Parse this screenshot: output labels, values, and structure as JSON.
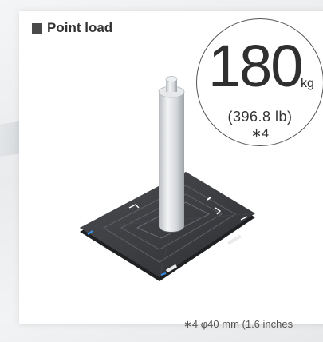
{
  "section": {
    "title": "Point load",
    "title_marker_icon": "square-bullet"
  },
  "load_badge": {
    "value": "180",
    "unit": "kg",
    "imperial": "(396.8 lb)",
    "note_ref": "∗4"
  },
  "footnote": {
    "text": "∗4 φ40 mm (1.6 inches"
  },
  "illustration": {
    "icon": "cylinder-on-floor-panel",
    "colors": {
      "panel": "#3b3d40",
      "cylinder": "#d9dcdf",
      "marker": "#ffffff"
    }
  }
}
